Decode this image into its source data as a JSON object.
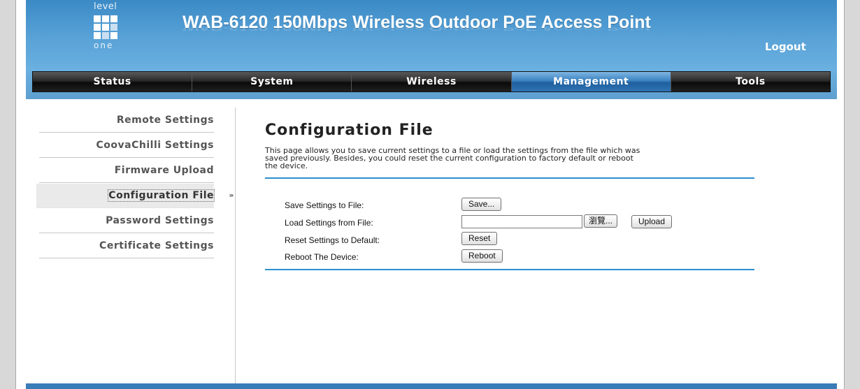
{
  "header": {
    "logo_top": "level",
    "logo_bottom": "one",
    "title": "WAB-6120 150Mbps Wireless Outdoor PoE Access Point",
    "logout_label": "Logout"
  },
  "nav": {
    "items": [
      {
        "label": "Status"
      },
      {
        "label": "System"
      },
      {
        "label": "Wireless"
      },
      {
        "label": "Management"
      },
      {
        "label": "Tools"
      }
    ],
    "active": "Management"
  },
  "sidebar": {
    "items": [
      {
        "label": "Remote Settings"
      },
      {
        "label": "CoovaChilli Settings"
      },
      {
        "label": "Firmware Upload"
      },
      {
        "label": "Configuration File"
      },
      {
        "label": "Password Settings"
      },
      {
        "label": "Certificate Settings"
      }
    ],
    "active": "Configuration File",
    "active_marker": "»"
  },
  "main": {
    "title": "Configuration File",
    "description_line1": "This page allows you to save current settings to a file or load the settings from the file which was",
    "description_line2": "saved previously. Besides, you could reset the current configuration to factory default or reboot",
    "description_line3": "the device.",
    "rows": {
      "save_label": "Save Settings to File:",
      "save_button": "Save...",
      "load_label": "Load Settings from File:",
      "browse_button": "瀏覽...",
      "upload_button": "Upload",
      "reset_label": "Reset Settings to Default:",
      "reset_button": "Reset",
      "reboot_label": "Reboot The Device:",
      "reboot_button": "Reboot"
    }
  },
  "colors": {
    "header_blue": "#4d9ad2",
    "nav_active": "#3c82c0",
    "rule_blue": "#2a8fcf"
  }
}
